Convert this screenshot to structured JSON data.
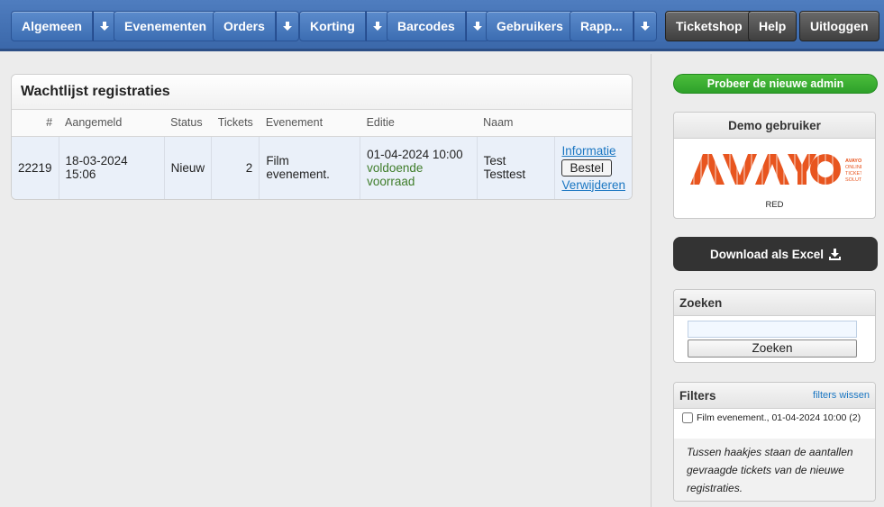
{
  "nav": {
    "algemeen": "Algemeen",
    "evenementen": "Evenementen",
    "orders": "Orders",
    "korting": "Korting",
    "barcodes": "Barcodes",
    "gebruikers": "Gebruikers",
    "rapportages": "Rapp...",
    "ticketshop": "Ticketshop",
    "help": "Help",
    "uitloggen": "Uitloggen",
    "drop_icon": "arrow-down-icon"
  },
  "main": {
    "title": "Wachtlijst registraties",
    "columns": [
      "#",
      "Aangemeld",
      "Status",
      "Tickets",
      "Evenement",
      "Editie",
      "Naam",
      ""
    ],
    "rows": [
      {
        "id": "22219",
        "registered": "18-03-2024 15:06",
        "status": "Nieuw",
        "tickets": "2",
        "event": "Film evenement.",
        "edition_date": "01-04-2024 10:00",
        "edition_stock": "voldoende voorraad",
        "name": "Test Testtest",
        "action_info": "Informatie",
        "action_order": "Bestel",
        "action_delete": "Verwijderen"
      }
    ]
  },
  "sidebar": {
    "try_new_admin": "Probeer de nieuwe admin",
    "demo_title": "Demo gebruiker",
    "logo_text": "AVAYO",
    "logo_tagline": [
      "AVAYO",
      "ONLINE",
      "TICKET",
      "SOLUTIONS"
    ],
    "logo_sub": "RED",
    "download_label": "Download als Excel",
    "download_icon": "download-icon",
    "search_title": "Zoeken",
    "search_value": "",
    "search_button": "Zoeken",
    "filters_title": "Filters",
    "filters_clear": "filters wissen",
    "filter_option": "Film evenement., 01-04-2024 10:00 (2)",
    "filters_note": "Tussen haakjes staan de aantallen gevraagde tickets van de nieuwe registraties."
  },
  "colors": {
    "nav_blue": "#3b68aa",
    "green_button": "#2ea12a",
    "logo_orange": "#e8551f",
    "link": "#1a76c2"
  }
}
